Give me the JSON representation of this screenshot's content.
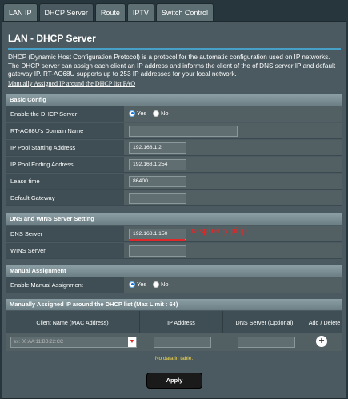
{
  "tabs": [
    {
      "label": "LAN IP"
    },
    {
      "label": "DHCP Server"
    },
    {
      "label": "Route"
    },
    {
      "label": "IPTV"
    },
    {
      "label": "Switch Control"
    }
  ],
  "page": {
    "title": "LAN - DHCP Server",
    "description": "DHCP (Dynamic Host Configuration Protocol) is a protocol for the automatic configuration used on IP networks. The DHCP server can assign each client an IP address and informs the client of the of DNS server IP and default gateway IP. RT-AC68U supports up to 253 IP addresses for your local network.",
    "faq_link": "Manually Assigned IP around the DHCP list FAQ"
  },
  "basic_config": {
    "header": "Basic Config",
    "enable_dhcp_label": "Enable the DHCP Server",
    "yes": "Yes",
    "no": "No",
    "enable_dhcp_value": "Yes",
    "domain_name_label": "RT-AC68U's Domain Name",
    "domain_name_value": "",
    "pool_start_label": "IP Pool Starting Address",
    "pool_start_value": "192.168.1.2",
    "pool_end_label": "IP Pool Ending Address",
    "pool_end_value": "192.168.1.254",
    "lease_label": "Lease time",
    "lease_value": "86400",
    "gateway_label": "Default Gateway",
    "gateway_value": ""
  },
  "dns_wins": {
    "header": "DNS and WINS Server Setting",
    "dns_label": "DNS Server",
    "dns_value": "192.168.1.150",
    "annotation": "raspberry pi ip",
    "wins_label": "WINS Server",
    "wins_value": ""
  },
  "manual_assignment": {
    "header": "Manual Assignment",
    "enable_label": "Enable Manual Assignment",
    "yes": "Yes",
    "no": "No",
    "value": "Yes"
  },
  "manual_list": {
    "header": "Manually Assigned IP around the DHCP list (Max Limit : 64)",
    "columns": [
      "Client Name (MAC Address)",
      "IP Address",
      "DNS Server (Optional)",
      "Add / Delete"
    ],
    "mac_placeholder": "ex: 00:AA:11:BB:22:CC",
    "add_icon": "plus-circle-icon",
    "empty_text": "No data in table."
  },
  "apply_label": "Apply",
  "colors": {
    "background": "#27363c",
    "panel": "#4a5a60",
    "accent_line": "#46a0c8",
    "annotation": "#e02a2a",
    "empty_text": "#f6d84a"
  }
}
